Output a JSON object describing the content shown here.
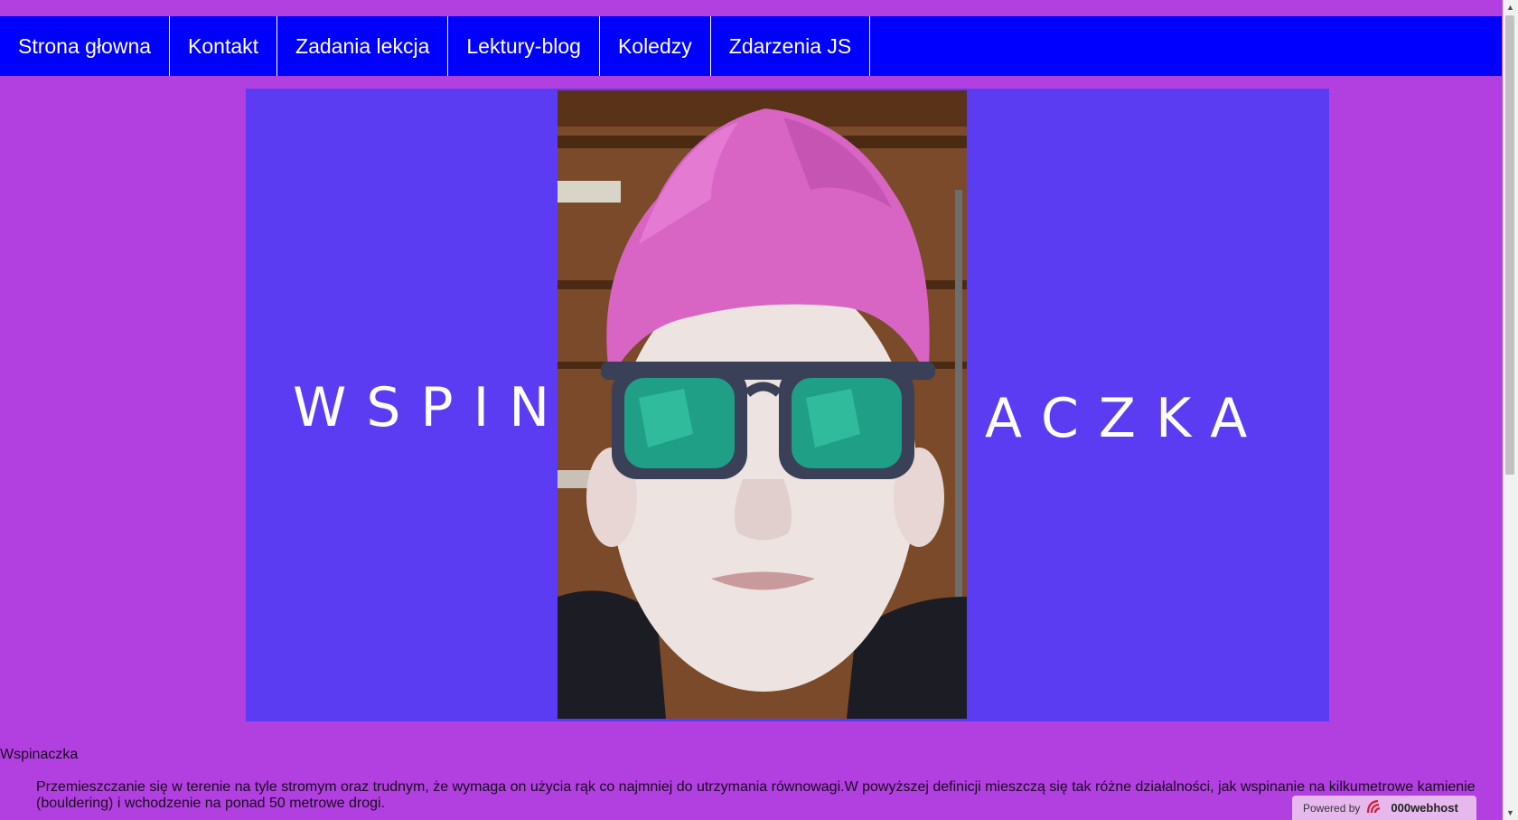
{
  "nav": {
    "items": [
      {
        "label": "Strona głowna"
      },
      {
        "label": "Kontakt"
      },
      {
        "label": "Zadania lekcja"
      },
      {
        "label": "Lektury-blog"
      },
      {
        "label": "Koledzy"
      },
      {
        "label": "Zdarzenia JS"
      }
    ]
  },
  "banner": {
    "left_text": "WSPIN",
    "right_text": "ACZKA"
  },
  "section": {
    "title": "Wspinaczka",
    "text": "Przemieszczanie się w terenie na tyle stromym oraz trudnym, że wymaga on użycia rąk co najmniej do utrzymania równowagi.W powyższej definicji mieszczą się tak różne działalności, jak wspinanie na kilkumetrowe kamienie (bouldering) i wchodzenie na ponad 50 metrowe drogi."
  },
  "badge": {
    "prefix": "Powered by",
    "brand": "000webhost"
  },
  "colors": {
    "page_background": "#b23fe0",
    "nav_background": "#0000ff",
    "banner_background": "#5b3cf2",
    "hair": "#d865c4"
  }
}
